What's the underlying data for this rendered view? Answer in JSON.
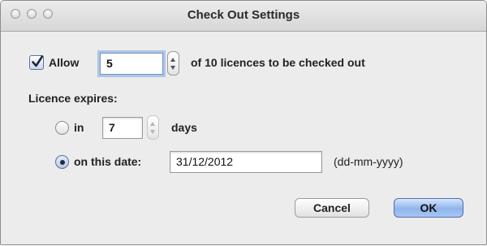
{
  "window": {
    "title": "Check Out Settings"
  },
  "allow": {
    "checkbox_label": "Allow",
    "checked": true,
    "count_value": "5",
    "suffix_text": "of 10 licences to be checked out"
  },
  "expiry": {
    "heading": "Licence expires:",
    "in_option_label": "in",
    "in_days_value": "7",
    "days_label": "days",
    "date_option_label": "on this date:",
    "date_value": "31/12/2012",
    "date_format_hint": "(dd-mm-yyyy)",
    "selected_option": "on this date"
  },
  "buttons": {
    "cancel_label": "Cancel",
    "ok_label": "OK"
  },
  "colors": {
    "window_background": "#ececec",
    "default_button": "#8fb4ec",
    "focus_ring": "#7da5e1"
  },
  "icons": {
    "close": "traffic-light-close",
    "minimize": "traffic-light-minimize",
    "zoom": "traffic-light-zoom",
    "checkmark": "checkmark-icon"
  }
}
